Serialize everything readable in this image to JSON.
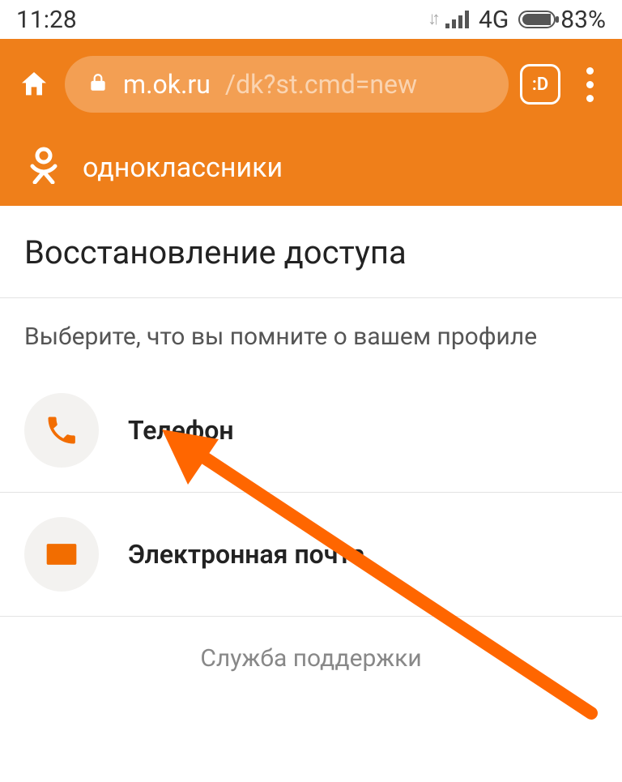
{
  "status": {
    "time": "11:28",
    "network_label": "4G",
    "battery_percent": "83%",
    "battery_fill_pct": 83
  },
  "browser": {
    "url_host": "m.ok.ru",
    "url_path": "/dk?st.cmd=new",
    "tabs_icon_label": ":D"
  },
  "page": {
    "brand": "одноклассники",
    "title": "Восстановление доступа",
    "subtitle": "Выберите, что вы помните о вашем профиле",
    "options": {
      "phone": "Телефон",
      "email": "Электронная почта"
    },
    "support": "Служба поддержки"
  }
}
